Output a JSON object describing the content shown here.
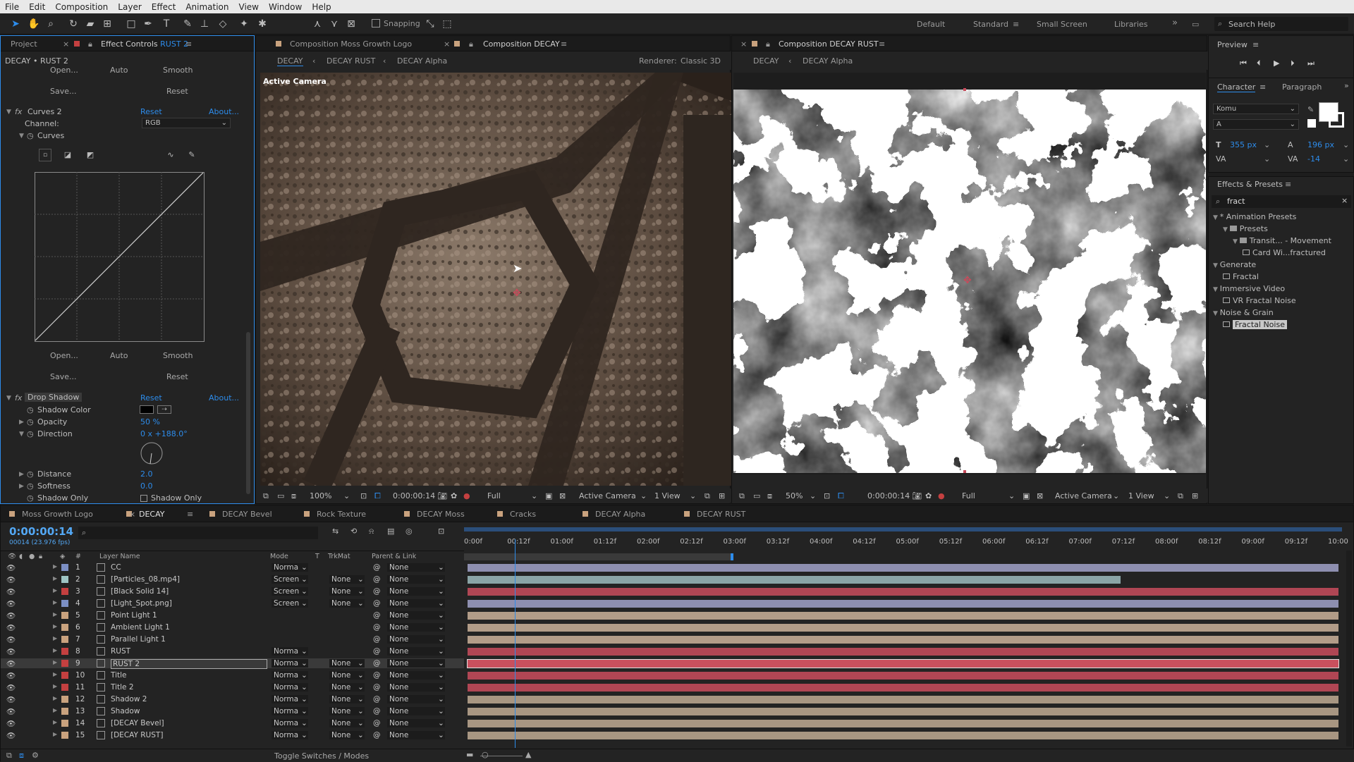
{
  "menu": [
    "File",
    "Edit",
    "Composition",
    "Layer",
    "Effect",
    "Animation",
    "View",
    "Window",
    "Help"
  ],
  "toolbar": {
    "snapping": "Snapping",
    "workspaces": [
      "Default",
      "Standard",
      "Small Screen",
      "Libraries"
    ],
    "search_placeholder": "Search Help"
  },
  "effect_controls": {
    "project_tab": "Project",
    "tab_prefix": "Effect Controls",
    "tab_layer": "RUST 2",
    "header": "DECAY • RUST 2",
    "top_buttons": [
      "Open...",
      "Auto",
      "Smooth",
      "Save...",
      "Reset"
    ],
    "curves": {
      "name": "Curves 2",
      "reset": "Reset",
      "about": "About...",
      "channel_label": "Channel:",
      "channel_value": "RGB",
      "curves_label": "Curves"
    },
    "bottom_buttons": [
      "Open...",
      "Auto",
      "Smooth",
      "Save...",
      "Reset"
    ],
    "drop_shadow": {
      "name": "Drop Shadow",
      "reset": "Reset",
      "about": "About...",
      "props": [
        {
          "label": "Shadow Color",
          "value": ""
        },
        {
          "label": "Opacity",
          "value": "50 %"
        },
        {
          "label": "Direction",
          "value": "0 x +188.0°"
        },
        {
          "label": "Distance",
          "value": "2.0"
        },
        {
          "label": "Softness",
          "value": "0.0"
        },
        {
          "label": "Shadow Only",
          "value": "Shadow Only"
        }
      ]
    }
  },
  "comp_viewer": {
    "tabs": [
      "Composition Moss Growth Logo",
      "Composition DECAY"
    ],
    "breadcrumbs": [
      "DECAY",
      "DECAY RUST",
      "DECAY Alpha"
    ],
    "renderer_label": "Renderer:",
    "renderer_value": "Classic 3D",
    "camera_label": "Active Camera",
    "zoom": "100%",
    "timecode": "0:00:00:14",
    "resolution": "Full",
    "camera": "Active Camera",
    "view": "1 View"
  },
  "rust_viewer": {
    "tab": "Composition DECAY RUST",
    "breadcrumbs": [
      "DECAY",
      "DECAY Alpha"
    ],
    "zoom": "50%",
    "timecode": "0:00:00:14",
    "resolution": "Full",
    "camera": "Active Camera",
    "view": "1 View"
  },
  "preview": {
    "title": "Preview"
  },
  "character": {
    "tabs": [
      "Character",
      "Paragraph"
    ],
    "font": "Komu",
    "style": "A",
    "size": "355 px",
    "leading": "196 px",
    "tracking": "-14"
  },
  "effects_presets": {
    "title": "Effects & Presets",
    "search": "fract",
    "tree": [
      {
        "label": "* Animation Presets",
        "depth": 0,
        "type": "folder"
      },
      {
        "label": "Presets",
        "depth": 1,
        "type": "folder"
      },
      {
        "label": "Transit... - Movement",
        "depth": 2,
        "type": "folder"
      },
      {
        "label": "Card Wi...fractured",
        "depth": 3,
        "type": "file"
      },
      {
        "label": "Generate",
        "depth": 0,
        "type": "folder"
      },
      {
        "label": "Fractal",
        "depth": 1,
        "type": "file"
      },
      {
        "label": "Immersive Video",
        "depth": 0,
        "type": "folder"
      },
      {
        "label": "VR Fractal Noise",
        "depth": 1,
        "type": "file"
      },
      {
        "label": "Noise & Grain",
        "depth": 0,
        "type": "folder"
      },
      {
        "label": "Fractal Noise",
        "depth": 1,
        "type": "file",
        "selected": true
      }
    ]
  },
  "timeline": {
    "tabs": [
      "Moss Growth Logo",
      "DECAY",
      "DECAY Bevel",
      "Rock Texture",
      "DECAY Moss",
      "Cracks",
      "DECAY Alpha",
      "DECAY RUST"
    ],
    "timecode": "0:00:00:14",
    "fps": "00014 (23.976 fps)",
    "headers": [
      "#",
      "Layer Name",
      "Mode",
      "T",
      "TrkMat",
      "Parent & Link"
    ],
    "ruler": [
      "0:00f",
      "00:12f",
      "01:00f",
      "01:12f",
      "02:00f",
      "02:12f",
      "03:00f",
      "03:12f",
      "04:00f",
      "04:12f",
      "05:00f",
      "05:12f",
      "06:00f",
      "06:12f",
      "07:00f",
      "07:12f",
      "08:00f",
      "08:12f",
      "09:00f",
      "09:12f",
      "10:00"
    ],
    "playhead_fraction": 0.058,
    "layers": [
      {
        "num": "1",
        "name": "CC",
        "color": "#7c8fc4",
        "mode": "Norma",
        "trk": "",
        "parent": "None",
        "bar": "#8e8fb0",
        "end": 1.0
      },
      {
        "num": "2",
        "name": "[Particles_08.mp4]",
        "color": "#9ec4c4",
        "mode": "Screen",
        "trk": "None",
        "parent": "None",
        "bar": "#8aa4a6",
        "end": 0.75
      },
      {
        "num": "3",
        "name": "[Black Solid 14]",
        "color": "#c44040",
        "mode": "Screen",
        "trk": "None",
        "parent": "None",
        "bar": "#b04654",
        "end": 1.0
      },
      {
        "num": "4",
        "name": "[Light_Spot.png]",
        "color": "#7c8fc4",
        "mode": "Screen",
        "trk": "None",
        "parent": "None",
        "bar": "#8e8fb0",
        "end": 1.0
      },
      {
        "num": "5",
        "name": "Point Light 1",
        "color": "#c9a27e",
        "mode": "",
        "trk": "",
        "parent": "None",
        "bar": "#b29c88",
        "end": 1.0
      },
      {
        "num": "6",
        "name": "Ambient Light 1",
        "color": "#c9a27e",
        "mode": "",
        "trk": "",
        "parent": "None",
        "bar": "#b29c88",
        "end": 1.0
      },
      {
        "num": "7",
        "name": "Parallel Light 1",
        "color": "#c9a27e",
        "mode": "",
        "trk": "",
        "parent": "None",
        "bar": "#b29c88",
        "end": 1.0
      },
      {
        "num": "8",
        "name": "RUST",
        "color": "#c44040",
        "mode": "Norma",
        "trk": "",
        "parent": "None",
        "bar": "#b04654",
        "end": 1.0
      },
      {
        "num": "9",
        "name": "RUST 2",
        "color": "#c44040",
        "mode": "Norma",
        "trk": "None",
        "parent": "None",
        "bar": "#c9505e",
        "end": 1.0,
        "selected": true
      },
      {
        "num": "10",
        "name": "Title",
        "color": "#c44040",
        "mode": "Norma",
        "trk": "None",
        "parent": "None",
        "bar": "#b04654",
        "end": 1.0
      },
      {
        "num": "11",
        "name": "Title 2",
        "color": "#c44040",
        "mode": "Norma",
        "trk": "None",
        "parent": "None",
        "bar": "#b04654",
        "end": 1.0
      },
      {
        "num": "12",
        "name": "Shadow 2",
        "color": "#c9a27e",
        "mode": "Norma",
        "trk": "None",
        "parent": "None",
        "bar": "#a89682",
        "end": 1.0
      },
      {
        "num": "13",
        "name": "Shadow",
        "color": "#c9a27e",
        "mode": "Norma",
        "trk": "None",
        "parent": "None",
        "bar": "#a89682",
        "end": 1.0
      },
      {
        "num": "14",
        "name": "[DECAY Bevel]",
        "color": "#c9a27e",
        "mode": "Norma",
        "trk": "None",
        "parent": "None",
        "bar": "#a89682",
        "end": 1.0
      },
      {
        "num": "15",
        "name": "[DECAY RUST]",
        "color": "#c9a27e",
        "mode": "Norma",
        "trk": "None",
        "parent": "None",
        "bar": "#a89682",
        "end": 1.0
      }
    ],
    "toggle_label": "Toggle Switches / Modes"
  }
}
